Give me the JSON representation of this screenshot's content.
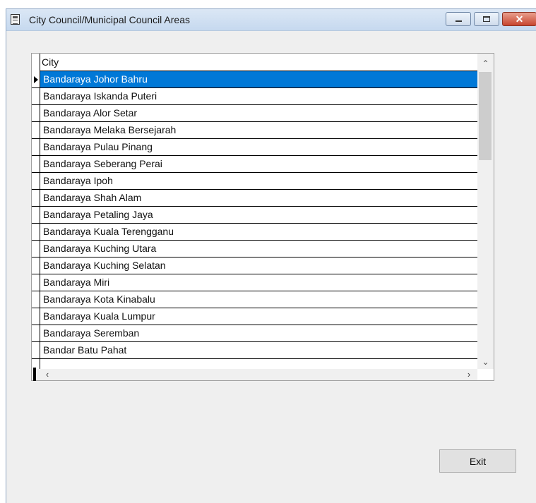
{
  "window": {
    "title": "City Council/Municipal Council Areas",
    "close_glyph": "✕"
  },
  "grid": {
    "column_header": "City",
    "selected_index": 0,
    "rows": [
      "Bandaraya Johor Bahru",
      "Bandaraya Iskanda Puteri",
      "Bandaraya Alor Setar",
      "Bandaraya Melaka Bersejarah",
      "Bandaraya Pulau Pinang",
      "Bandaraya Seberang Perai",
      "Bandaraya Ipoh",
      "Bandaraya Shah Alam",
      "Bandaraya Petaling Jaya",
      "Bandaraya Kuala Terengganu",
      "Bandaraya Kuching Utara",
      "Bandaraya Kuching Selatan",
      "Bandaraya Miri",
      "Bandaraya Kota Kinabalu",
      "Bandaraya Kuala Lumpur",
      "Bandaraya Seremban",
      "Bandar Batu Pahat"
    ],
    "scroll": {
      "up_glyph": "⌃",
      "down_glyph": "⌄",
      "left_glyph": "‹",
      "right_glyph": "›"
    }
  },
  "buttons": {
    "exit_label": "Exit"
  },
  "colors": {
    "selection": "#0078d7",
    "window_bg": "#efefef"
  }
}
